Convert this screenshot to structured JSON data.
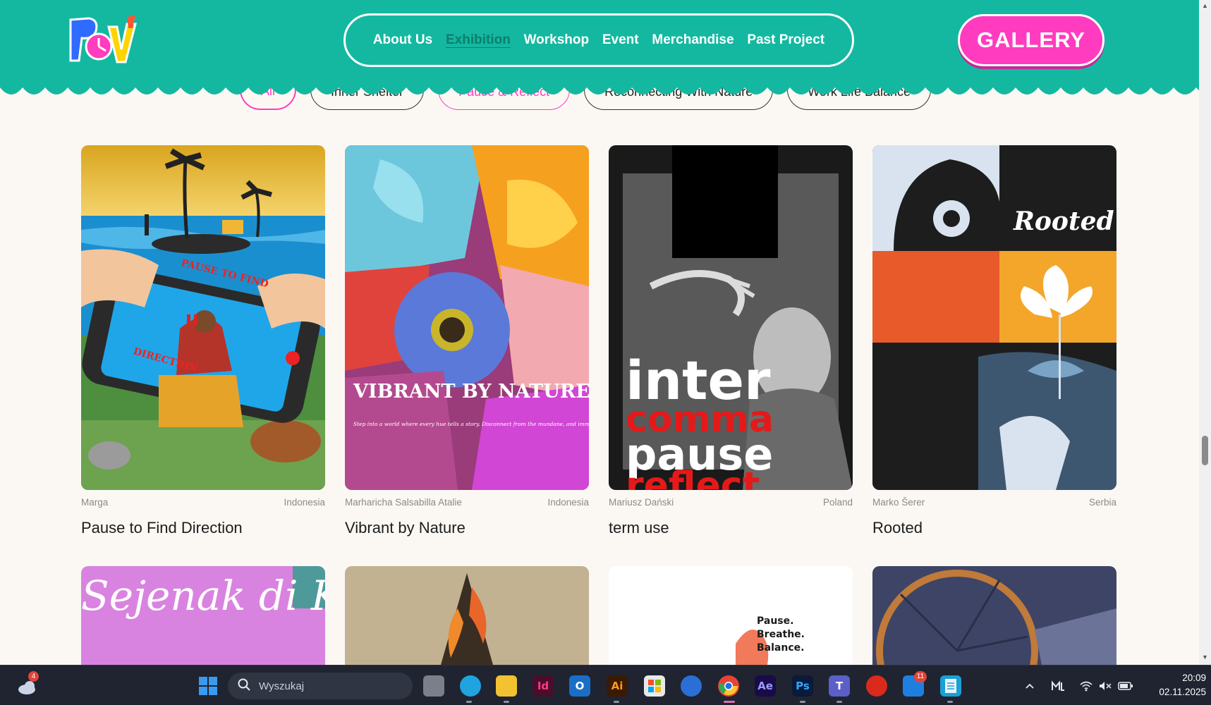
{
  "header": {
    "logo_alt": "POV",
    "nav": [
      {
        "label": "About Us",
        "active": false
      },
      {
        "label": "Exhibition",
        "active": true
      },
      {
        "label": "Workshop",
        "active": false
      },
      {
        "label": "Event",
        "active": false
      },
      {
        "label": "Merchandise",
        "active": false
      },
      {
        "label": "Past Project",
        "active": false
      }
    ],
    "gallery_label": "GALLERY"
  },
  "filters": [
    "All",
    "Inner Shelter",
    "Pause & Reflect",
    "Reconnecting With Nature",
    "Work Life Balance"
  ],
  "cards": [
    {
      "artist": "Marga",
      "country": "Indonesia",
      "title": "Pause to Find Direction"
    },
    {
      "artist": "Marharicha Salsabilla Atalie",
      "country": "Indonesia",
      "title": "Vibrant by Nature"
    },
    {
      "artist": "Mariusz Dański",
      "country": "Poland",
      "title": "term use"
    },
    {
      "artist": "Marko Šerer",
      "country": "Serbia",
      "title": "Rooted"
    }
  ],
  "poster_text": {
    "p1_phone": "PAUSE TO FIND",
    "p1_bottom": "DIRECTION",
    "p2_title": "VIBRANT BY NATURE.",
    "p2_body": "Step into a world where every hue tells a story. Disconnect from the mundane, and immerse yourself in the living art of the wild.",
    "p3_words": [
      "inter",
      "comma",
      "pause",
      "reflect"
    ],
    "p4_word": "Rooted",
    "r2_p1": "Sejenak di Kotak Kosong",
    "r2_p3": [
      "Pause.",
      "Breathe.",
      "Balance."
    ]
  },
  "taskbar": {
    "search_placeholder": "Wyszukaj",
    "weather_badge": "4",
    "teams_badge": "11",
    "time": "20:09",
    "date": "02.11.2025"
  }
}
